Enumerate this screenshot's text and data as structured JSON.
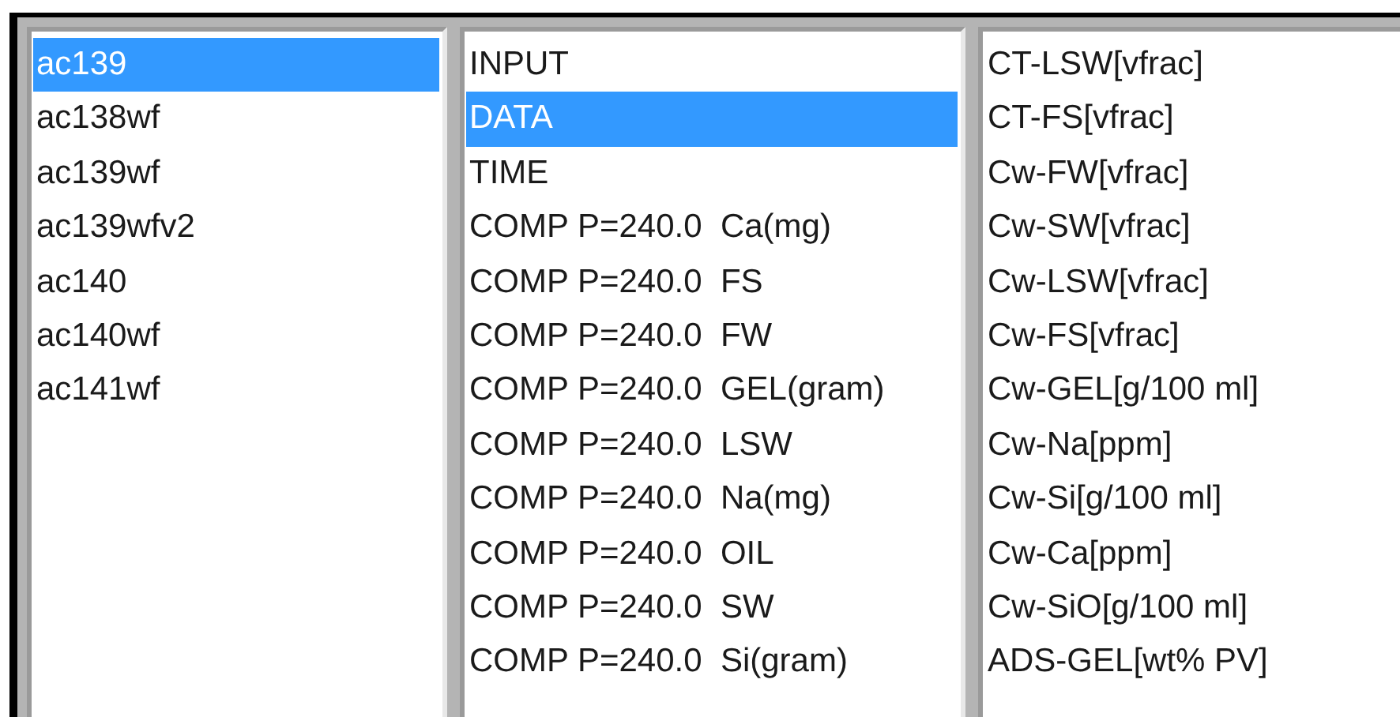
{
  "lists": [
    {
      "items": [
        {
          "label": "ac139",
          "selected": true
        },
        {
          "label": "ac138wf",
          "selected": false
        },
        {
          "label": "ac139wf",
          "selected": false
        },
        {
          "label": "ac139wfv2",
          "selected": false
        },
        {
          "label": "ac140",
          "selected": false
        },
        {
          "label": "ac140wf",
          "selected": false
        },
        {
          "label": "ac141wf",
          "selected": false
        }
      ]
    },
    {
      "items": [
        {
          "label": "INPUT",
          "selected": false
        },
        {
          "label": "DATA",
          "selected": true
        },
        {
          "label": "TIME",
          "selected": false
        },
        {
          "label": "COMP P=240.0  Ca(mg)",
          "selected": false
        },
        {
          "label": "COMP P=240.0  FS",
          "selected": false
        },
        {
          "label": "COMP P=240.0  FW",
          "selected": false
        },
        {
          "label": "COMP P=240.0  GEL(gram)",
          "selected": false
        },
        {
          "label": "COMP P=240.0  LSW",
          "selected": false
        },
        {
          "label": "COMP P=240.0  Na(mg)",
          "selected": false
        },
        {
          "label": "COMP P=240.0  OIL",
          "selected": false
        },
        {
          "label": "COMP P=240.0  SW",
          "selected": false
        },
        {
          "label": "COMP P=240.0  Si(gram)",
          "selected": false
        }
      ]
    },
    {
      "items": [
        {
          "label": "CT-LSW[vfrac]",
          "selected": false
        },
        {
          "label": "CT-FS[vfrac]",
          "selected": false
        },
        {
          "label": "Cw-FW[vfrac]",
          "selected": false
        },
        {
          "label": "Cw-SW[vfrac]",
          "selected": false
        },
        {
          "label": "Cw-LSW[vfrac]",
          "selected": false
        },
        {
          "label": "Cw-FS[vfrac]",
          "selected": false
        },
        {
          "label": "Cw-GEL[g/100 ml]",
          "selected": false
        },
        {
          "label": "Cw-Na[ppm]",
          "selected": false
        },
        {
          "label": "Cw-Si[g/100 ml]",
          "selected": false
        },
        {
          "label": "Cw-Ca[ppm]",
          "selected": false
        },
        {
          "label": "Cw-SiO[g/100 ml]",
          "selected": false
        },
        {
          "label": "ADS-GEL[wt% PV]",
          "selected": false
        }
      ]
    }
  ]
}
